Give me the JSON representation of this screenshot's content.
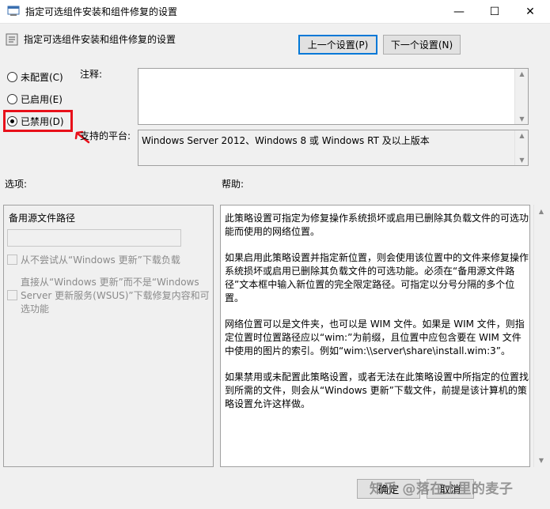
{
  "window": {
    "title": "指定可选组件安装和组件修复的设置",
    "minimize_symbol": "—",
    "maximize_symbol": "☐",
    "close_symbol": "✕"
  },
  "header": {
    "setting_name": "指定可选组件安装和组件修复的设置",
    "prev_button": "上一个设置(P)",
    "next_button": "下一个设置(N)"
  },
  "state": {
    "options": [
      {
        "label": "未配置(C)",
        "selected": false
      },
      {
        "label": "已启用(E)",
        "selected": false
      },
      {
        "label": "已禁用(D)",
        "selected": true
      }
    ],
    "highlight_color": "#e8101a"
  },
  "comment": {
    "label": "注释:",
    "value": ""
  },
  "supported_on": {
    "label": "支持的平台:",
    "value": "Windows Server 2012、Windows 8 或 Windows RT 及以上版本"
  },
  "sections": {
    "options_label": "选项:",
    "help_label": "帮助:"
  },
  "options_panel": {
    "alternate_path_label": "备用源文件路径",
    "alternate_path_value": "",
    "checkbox1_label": "从不尝试从“Windows 更新”下载负载",
    "checkbox2_label": "直接从“Windows 更新”而不是“Windows Server 更新服务(WSUS)”下载修复内容和可选功能"
  },
  "help": {
    "paragraphs": [
      "此策略设置可指定为修复操作系统损坏或启用已删除其负载文件的可选功能而使用的网络位置。",
      "如果启用此策略设置并指定新位置，则会使用该位置中的文件来修复操作系统损坏或启用已删除其负载文件的可选功能。必须在“备用源文件路径”文本框中输入新位置的完全限定路径。可指定以分号分隔的多个位置。",
      "网络位置可以是文件夹，也可以是 WIM 文件。如果是 WIM 文件，则指定位置时位置路径应以“wim:”为前缀，且位置中应包含要在 WIM 文件中使用的图片的索引。例如“wim:\\\\server\\share\\install.wim:3”。",
      "如果禁用或未配置此策略设置，或者无法在此策略设置中所指定的位置找到所需的文件，则会从“Windows 更新”下载文件，前提是该计算机的策略设置允许这样做。"
    ]
  },
  "footer": {
    "ok_button": "确定",
    "cancel_button": "取消",
    "watermark": "知乎 @落在土里的麦子"
  },
  "icons": [
    "policy-window-icon",
    "policy-setting-icon",
    "red-arrow-icon"
  ]
}
